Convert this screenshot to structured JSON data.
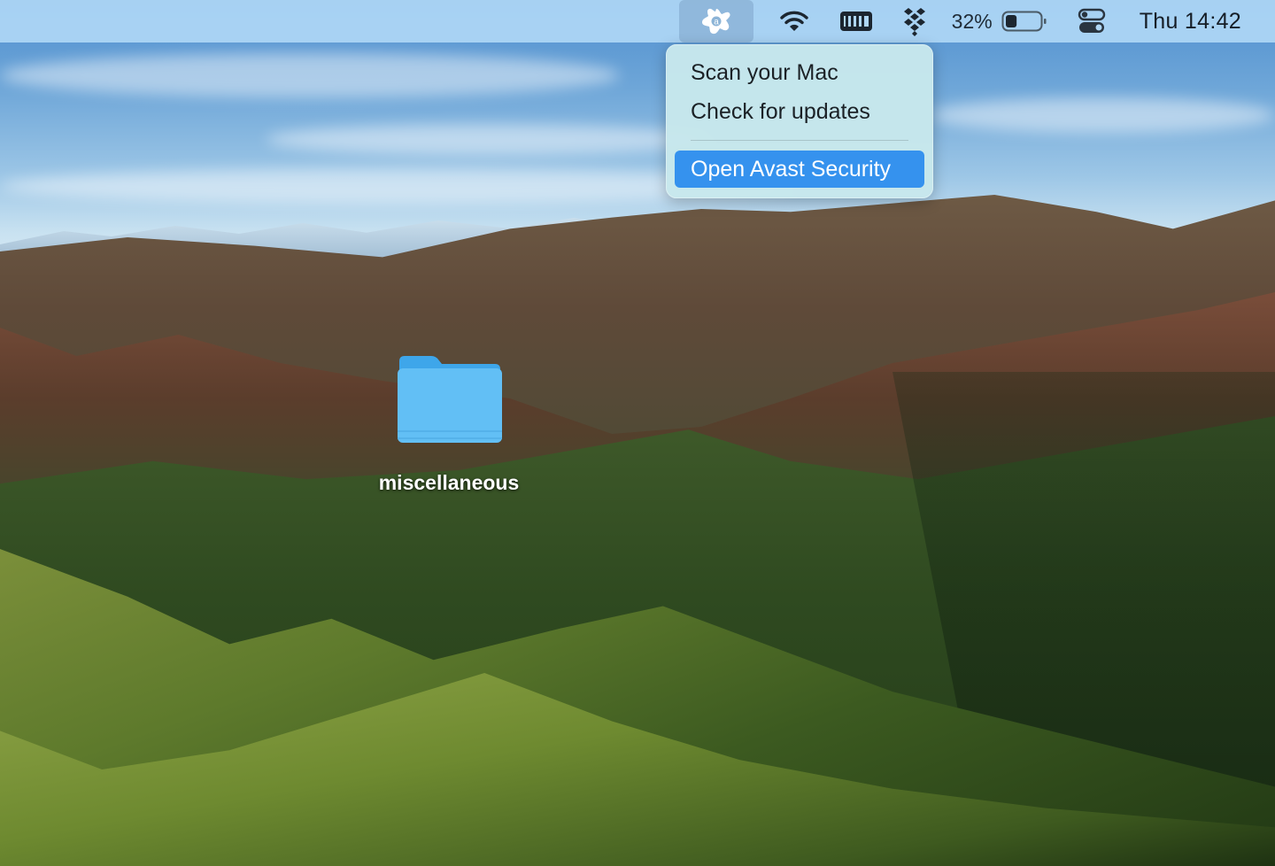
{
  "menubar": {
    "status_items": [
      {
        "id": "avast",
        "icon": "avast-icon",
        "active": true
      },
      {
        "id": "wifi",
        "icon": "wifi-icon"
      },
      {
        "id": "memory",
        "icon": "memory-icon"
      },
      {
        "id": "dropbox",
        "icon": "dropbox-icon"
      },
      {
        "id": "battery",
        "icon": "battery-icon",
        "percent_label": "32%",
        "level": 0.32
      },
      {
        "id": "control-center",
        "icon": "control-center-icon"
      }
    ],
    "clock": "Thu 14:42"
  },
  "avast_menu": {
    "items": [
      {
        "label": "Scan your Mac",
        "highlighted": false
      },
      {
        "label": "Check for updates",
        "highlighted": false
      },
      {
        "separator": true
      },
      {
        "label": "Open Avast Security",
        "highlighted": true
      }
    ],
    "highlight_color": "#3592ee"
  },
  "desktop": {
    "icons": [
      {
        "label": "miscellaneous",
        "type": "folder",
        "icon": "folder-icon",
        "color": "#62bff5"
      }
    ]
  }
}
